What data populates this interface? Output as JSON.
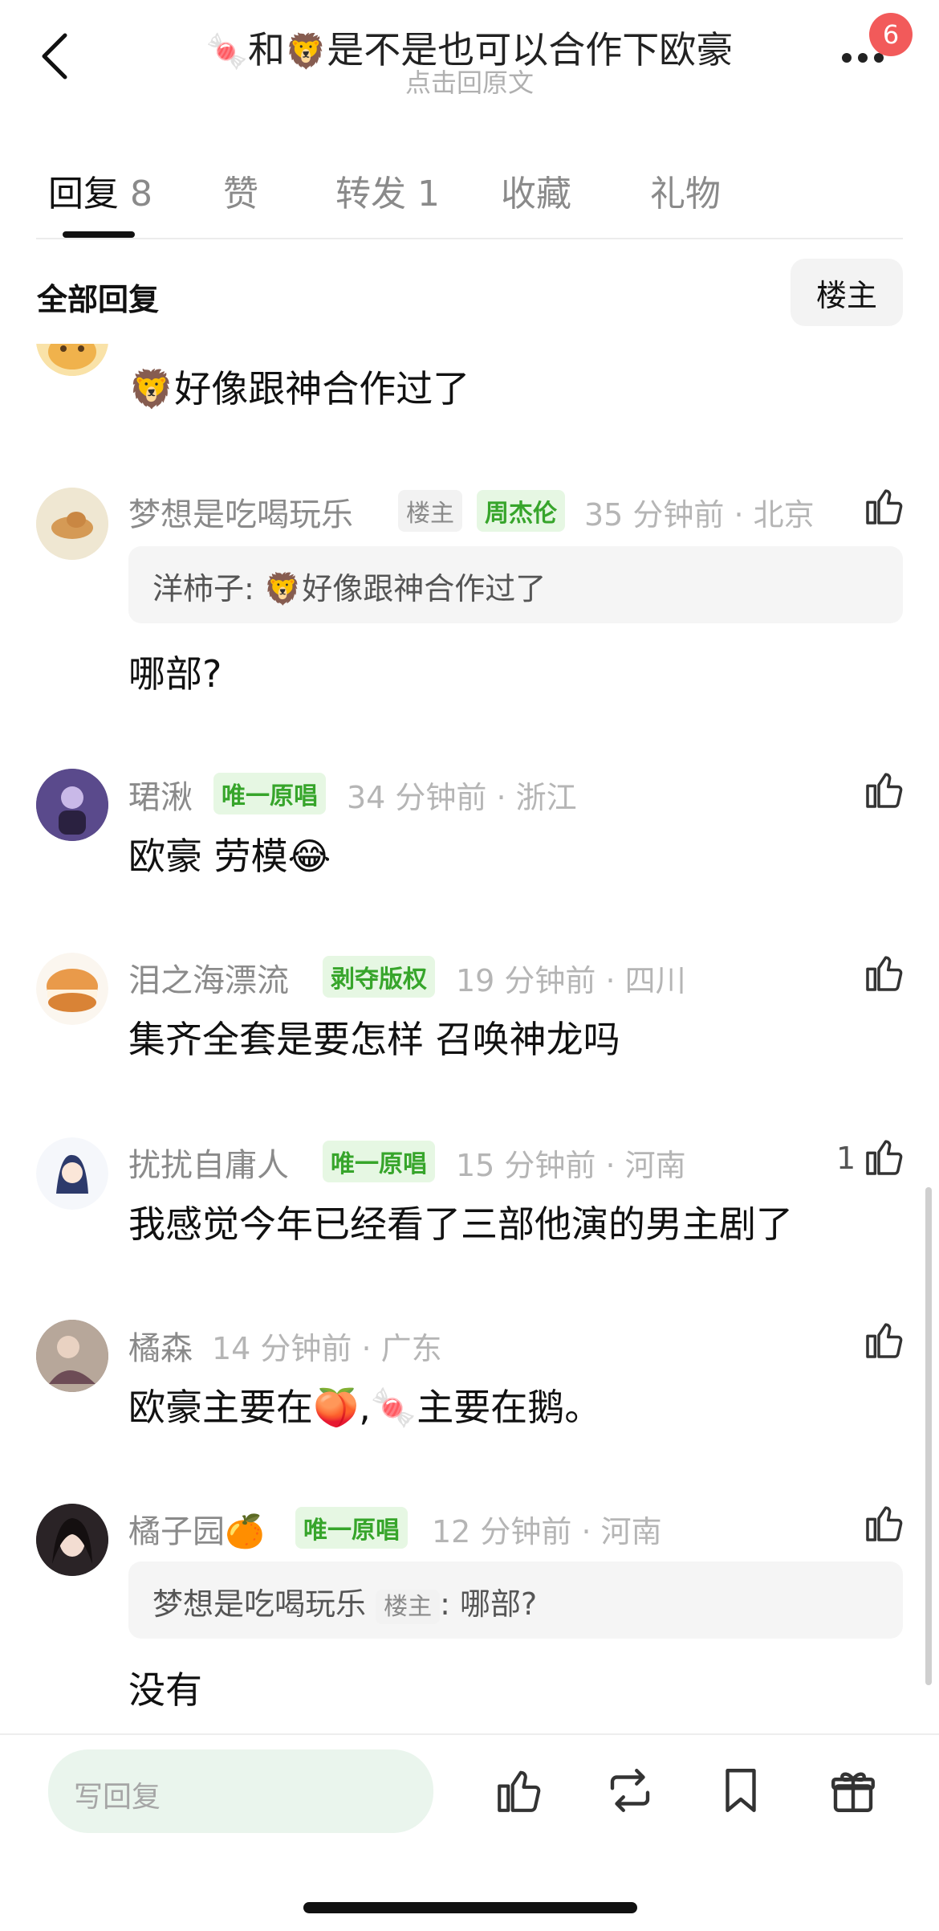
{
  "header": {
    "title_emoji_1": "🍬",
    "title_part_1": "和",
    "title_emoji_2": "🦁",
    "title_part_2": "是不是也可以合作下欧豪",
    "subtitle": "点击回原文",
    "notification_count": "6"
  },
  "tabs": [
    {
      "label": "回复",
      "count": "8",
      "active": true
    },
    {
      "label": "赞",
      "count": ""
    },
    {
      "label": "转发",
      "count": "1"
    },
    {
      "label": "收藏",
      "count": ""
    },
    {
      "label": "礼物",
      "count": ""
    }
  ],
  "filter": {
    "label": "全部回复",
    "owner_button": "楼主"
  },
  "comments": [
    {
      "emoji": "🦁",
      "text": "好像跟神合作过了"
    },
    {
      "user": "梦想是吃喝玩乐",
      "tags": [
        "楼主",
        "周杰伦"
      ],
      "time": "35 分钟前 · 北京",
      "quote": {
        "user": "洋柿子",
        "emoji": "🦁",
        "text": "好像跟神合作过了"
      },
      "text": "哪部?"
    },
    {
      "user": "珺湫",
      "tags": [
        "唯一原唱"
      ],
      "time": "34 分钟前 · 浙江",
      "text": "欧豪 劳模",
      "emoji": "😂"
    },
    {
      "user": "泪之海漂流",
      "tags": [
        "剥夺版权"
      ],
      "time": "19 分钟前 · 四川",
      "text": "集齐全套是要怎样 召唤神龙吗"
    },
    {
      "user": "扰扰自庸人",
      "tags": [
        "唯一原唱"
      ],
      "time": "15 分钟前 · 河南",
      "likes": "1",
      "text": "我感觉今年已经看了三部他演的男主剧了"
    },
    {
      "user": "橘森",
      "time": "14 分钟前 · 广东",
      "text_1": "欧豪主要在",
      "emoji_1": "🍑",
      "text_2": ",",
      "emoji_2": "🍬",
      "text_3": "主要在鹅。"
    },
    {
      "user": "橘子园",
      "user_emoji": "🍊",
      "tags": [
        "唯一原唱"
      ],
      "time": "12 分钟前 · 河南",
      "quote": {
        "user": "梦想是吃喝玩乐",
        "tag": "楼主",
        "text": "哪部?"
      },
      "text": "没有"
    }
  ],
  "bottom": {
    "placeholder": "写回复"
  },
  "icons": [
    "back-arrow-icon",
    "more-icon",
    "thumbs-up-icon",
    "repost-icon",
    "bookmark-icon",
    "gift-icon"
  ],
  "colors": {
    "accent_green": "#37a52b",
    "tag_green_bg": "#e6f7e3",
    "badge_red": "#f25a5a",
    "input_bg": "#eaf5ed"
  }
}
